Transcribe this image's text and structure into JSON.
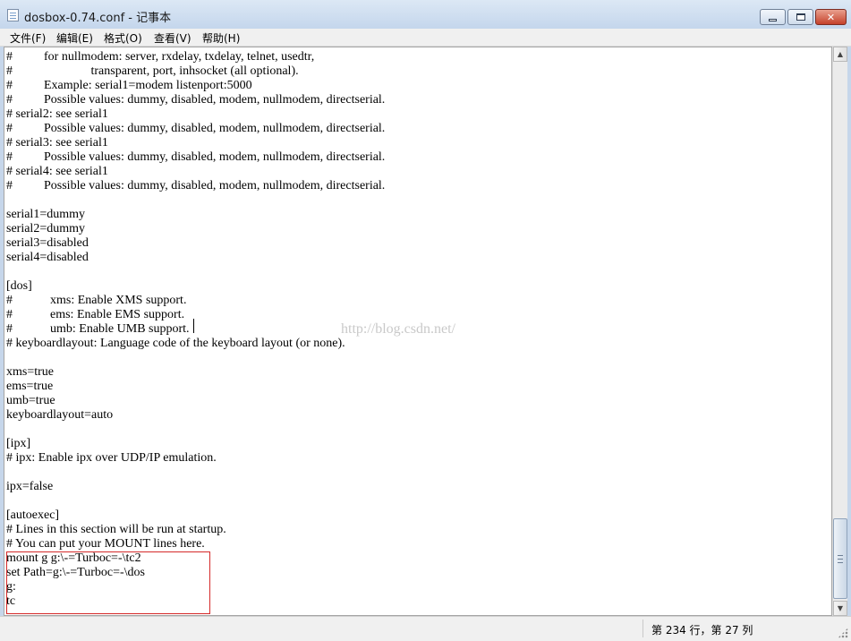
{
  "window": {
    "title": "dosbox-0.74.conf - 记事本",
    "close_glyph": "✕"
  },
  "menu": [
    {
      "label": "文件(F)"
    },
    {
      "label": "编辑(E)"
    },
    {
      "label": "格式(O)"
    },
    {
      "label": "查看(V)"
    },
    {
      "label": "帮助(H)"
    }
  ],
  "editor": {
    "lines": [
      "#          for nullmodem: server, rxdelay, txdelay, telnet, usedtr,",
      "#                         transparent, port, inhsocket (all optional).",
      "#          Example: serial1=modem listenport:5000",
      "#          Possible values: dummy, disabled, modem, nullmodem, directserial.",
      "# serial2: see serial1",
      "#          Possible values: dummy, disabled, modem, nullmodem, directserial.",
      "# serial3: see serial1",
      "#          Possible values: dummy, disabled, modem, nullmodem, directserial.",
      "# serial4: see serial1",
      "#          Possible values: dummy, disabled, modem, nullmodem, directserial.",
      "",
      "serial1=dummy",
      "serial2=dummy",
      "serial3=disabled",
      "serial4=disabled",
      "",
      "[dos]",
      "#            xms: Enable XMS support.",
      "#            ems: Enable EMS support.",
      "#            umb: Enable UMB support.",
      "# keyboardlayout: Language code of the keyboard layout (or none).",
      "",
      "xms=true",
      "ems=true",
      "umb=true",
      "keyboardlayout=auto",
      "",
      "[ipx]",
      "# ipx: Enable ipx over UDP/IP emulation.",
      "",
      "ipx=false",
      "",
      "[autoexec]",
      "# Lines in this section will be run at startup.",
      "# You can put your MOUNT lines here.",
      "mount g g:\\-=Turboc=-\\tc2",
      "set Path=g:\\-=Turboc=-\\dos",
      "g:",
      "tc"
    ],
    "watermark": "http://blog.csdn.net/"
  },
  "scrollbar": {
    "up_glyph": "▲",
    "down_glyph": "▼",
    "position": 0.94
  },
  "status": {
    "position_text": "第 234 行，第 27 列"
  }
}
